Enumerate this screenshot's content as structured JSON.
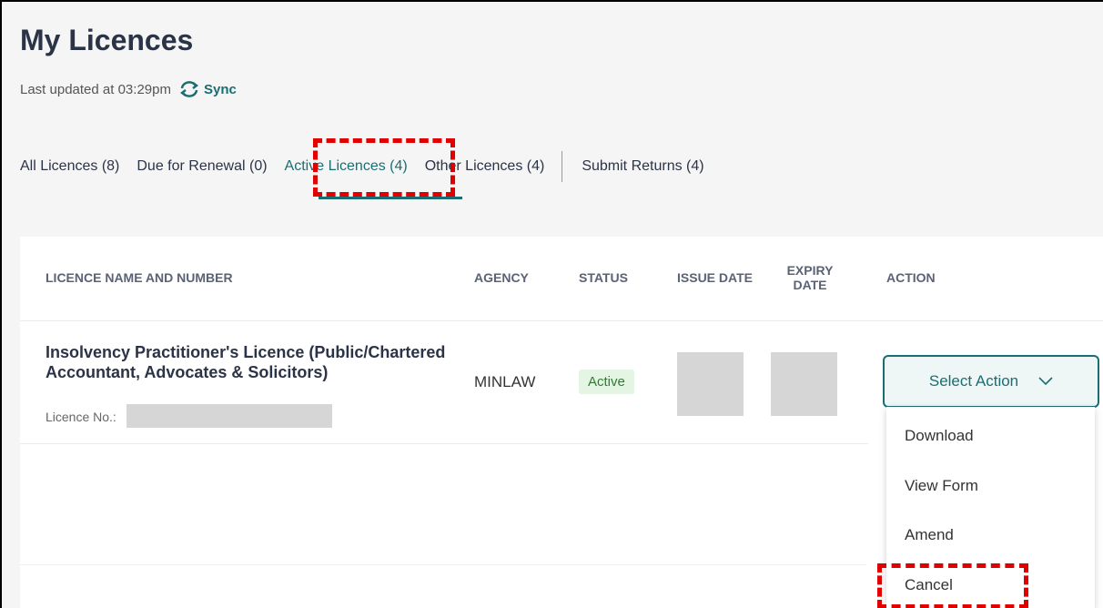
{
  "page": {
    "title": "My Licences",
    "last_updated": "Last updated at 03:29pm",
    "sync_label": "Sync"
  },
  "tabs": [
    {
      "label": "All Licences (8)",
      "active": false
    },
    {
      "label": "Due for Renewal (0)",
      "active": false
    },
    {
      "label": "Active Licences (4)",
      "active": true
    },
    {
      "label": "Other Licences (4)",
      "active": false
    },
    {
      "label": "Submit Returns (4)",
      "active": false
    }
  ],
  "table": {
    "headers": {
      "name": "LICENCE NAME AND NUMBER",
      "agency": "AGENCY",
      "status": "STATUS",
      "issue_date": "ISSUE DATE",
      "expiry_date": "EXPIRY DATE",
      "action": "ACTION"
    },
    "rows": [
      {
        "name": "Insolvency Practitioner's Licence (Public/Chartered Accountant, Advocates & Solicitors)",
        "licence_no_label": "Licence No.:",
        "agency": "MINLAW",
        "status": "Active"
      }
    ]
  },
  "action_menu": {
    "button_label": "Select Action",
    "items": [
      "Download",
      "View Form",
      "Amend",
      "Cancel"
    ]
  },
  "colors": {
    "accent": "#1a6e73",
    "highlight": "#e00000",
    "status_bg": "#e4f5e4",
    "status_text": "#2e7d32"
  },
  "icons": {
    "sync": "sync-icon",
    "dropdown": "chevron-down-icon"
  }
}
